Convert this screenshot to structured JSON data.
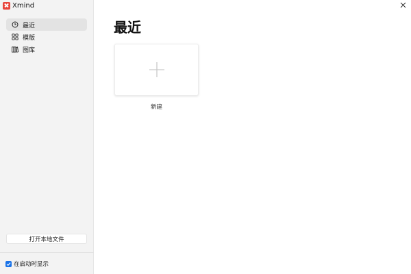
{
  "app": {
    "name": "Xmind",
    "accent_color": "#e8453c"
  },
  "sidebar": {
    "items": [
      {
        "label": "最近",
        "icon": "clock-icon",
        "active": true
      },
      {
        "label": "模版",
        "icon": "template-grid-icon",
        "active": false
      },
      {
        "label": "图库",
        "icon": "library-icon",
        "active": false
      }
    ],
    "open_local_label": "打开本地文件",
    "startup_label": "在启动时显示",
    "startup_checked": true
  },
  "main": {
    "title": "最近",
    "new_label": "新建",
    "close_icon": "close-icon"
  }
}
